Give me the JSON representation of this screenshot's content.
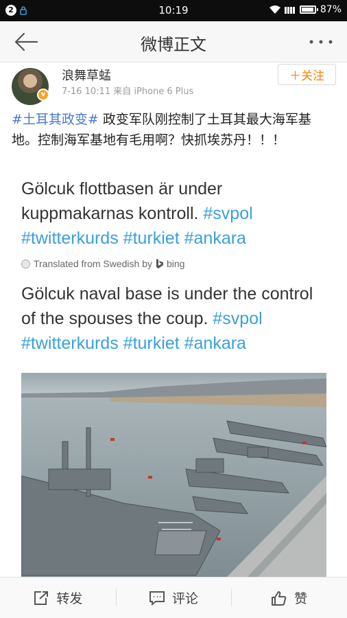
{
  "status_bar": {
    "notification_count": "2",
    "time": "10:19",
    "battery": "87%"
  },
  "header": {
    "title": "微博正文",
    "back_icon": "arrow-left-icon",
    "more_icon": "more-dots-icon"
  },
  "post": {
    "author": "浪舞草蜢",
    "verified_badge": "v",
    "meta": "7-16 10:11  来自 iPhone 6 Plus",
    "follow_label": "＋关注",
    "hashtag": "#土耳其政变#",
    "text": " 政变军队刚控制了土耳其最大海军基地。控制海军基地有毛用啊？快抓埃苏丹！！！",
    "embed": {
      "original_text": "Gölcuk flottbasen är under kuppmakarnas kontroll. ",
      "original_tags": [
        "#svpol",
        "#twitterkurds",
        "#turkiet",
        "#ankara"
      ],
      "translated_label": "Translated from Swedish by",
      "translator": "bing",
      "translated_text": "Gölcuk naval base is under the control of the spouses the coup. ",
      "translated_tags": [
        "#svpol",
        "#twitterkurds",
        "#turkiet",
        "#ankara"
      ]
    },
    "photo_desc": "warships docked at naval base"
  },
  "actions": [
    {
      "label": "转发",
      "icon": "repost-icon"
    },
    {
      "label": "评论",
      "icon": "comment-icon"
    },
    {
      "label": "赞",
      "icon": "thumbs-up-icon"
    }
  ],
  "colors": {
    "hashtag": "#4a78c9",
    "twitter_tag": "#3aa0d8",
    "follow": "#ff8200",
    "verified": "#f5a623"
  }
}
